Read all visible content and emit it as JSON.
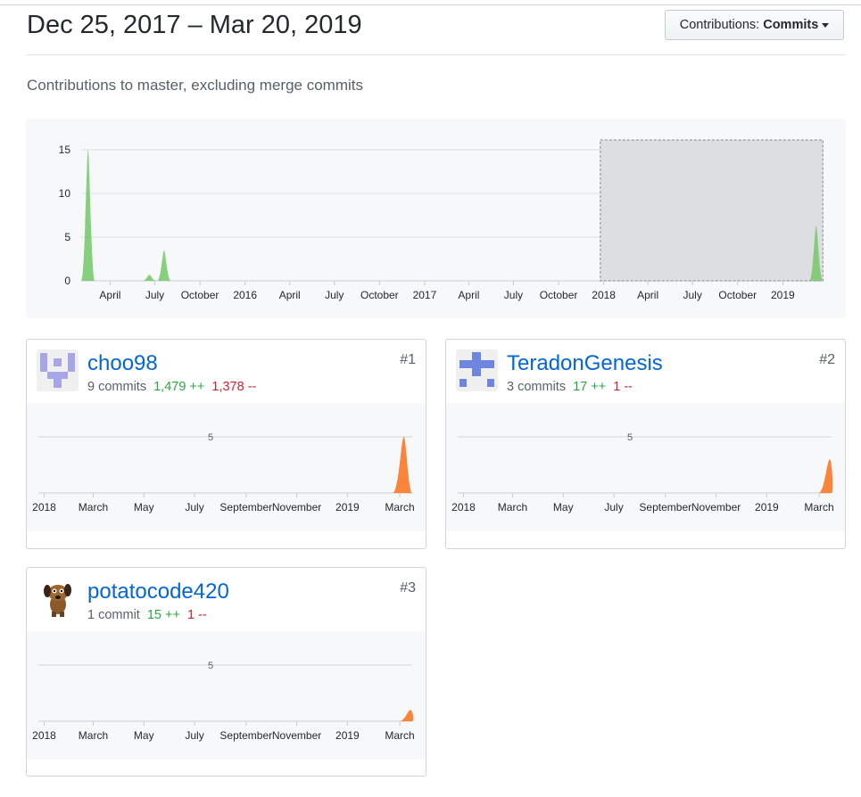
{
  "header": {
    "date_range": "Dec 25, 2017 – Mar 20, 2019",
    "dropdown_prefix": "Contributions:",
    "dropdown_value": "Commits",
    "subtitle": "Contributions to master, excluding merge commits"
  },
  "chart_data": [
    {
      "type": "area",
      "title": "",
      "ylim": [
        0,
        15
      ],
      "y_ticks": [
        "0",
        "5",
        "10",
        "15"
      ],
      "x_ticks": [
        "April",
        "July",
        "October",
        "2016",
        "April",
        "July",
        "October",
        "2017",
        "April",
        "July",
        "October",
        "2018",
        "April",
        "July",
        "October",
        "2019"
      ],
      "x_range": [
        "2015-02",
        "2019-03"
      ],
      "selection": [
        "2017-12-25",
        "2019-03-20"
      ],
      "color": "#7bc96f",
      "points": [
        {
          "x": "2015-02-15",
          "y": 15
        },
        {
          "x": "2015-06-20",
          "y": 0.7
        },
        {
          "x": "2015-07-20",
          "y": 3.5
        },
        {
          "x": "2019-03-10",
          "y": 6.3
        }
      ]
    },
    {
      "type": "area",
      "ylim": [
        0,
        5
      ],
      "y_ticks": [
        "5"
      ],
      "x_ticks": [
        "2018",
        "March",
        "May",
        "July",
        "September",
        "November",
        "2019",
        "March"
      ],
      "color": "#f9843a",
      "points": [
        {
          "x": "2019-03-10",
          "y": 5
        }
      ]
    },
    {
      "type": "area",
      "ylim": [
        0,
        5
      ],
      "y_ticks": [
        "5"
      ],
      "x_ticks": [
        "2018",
        "March",
        "May",
        "July",
        "September",
        "November",
        "2019",
        "March"
      ],
      "color": "#f9843a",
      "points": [
        {
          "x": "2019-03-18",
          "y": 3
        }
      ]
    },
    {
      "type": "area",
      "ylim": [
        0,
        5
      ],
      "y_ticks": [
        "5"
      ],
      "x_ticks": [
        "2018",
        "March",
        "May",
        "July",
        "September",
        "November",
        "2019",
        "March"
      ],
      "color": "#f9843a",
      "points": [
        {
          "x": "2019-03-18",
          "y": 1
        }
      ]
    }
  ],
  "contributors": [
    {
      "name": "choo98",
      "commits": "9 commits",
      "additions": "1,479 ++",
      "deletions": "1,378 --",
      "rank": "#1",
      "avatar": "identicon-purple-w"
    },
    {
      "name": "TeradonGenesis",
      "commits": "3 commits",
      "additions": "17 ++",
      "deletions": "1 --",
      "rank": "#2",
      "avatar": "identicon-blue-cross"
    },
    {
      "name": "potatocode420",
      "commits": "1 commit",
      "additions": "15 ++",
      "deletions": "1 --",
      "rank": "#3",
      "avatar": "dog-avatar"
    }
  ]
}
